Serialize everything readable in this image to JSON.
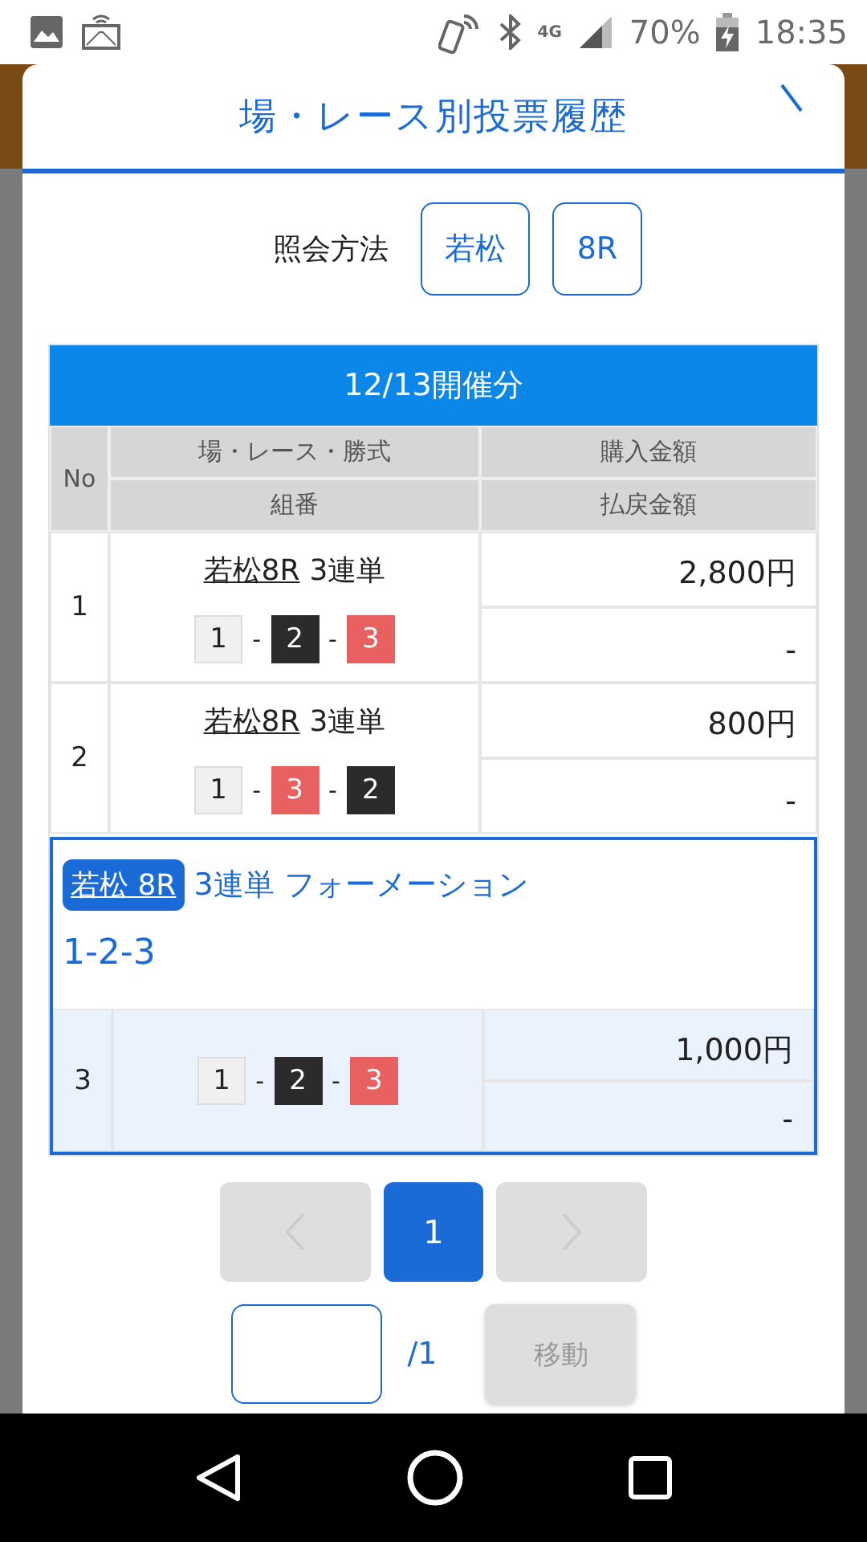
{
  "status_bar": {
    "network": "4G",
    "battery": "70%",
    "time": "18:35"
  },
  "dialog": {
    "title": "場・レース別投票履歴"
  },
  "query": {
    "label": "照会方法",
    "buttons": [
      "若松",
      "8R"
    ]
  },
  "table": {
    "date_header": "12/13開催分",
    "columns": {
      "no": "No",
      "race": "場・レース・勝式",
      "combo": "組番",
      "purchase": "購入金額",
      "payout": "払戻金額"
    },
    "rows": [
      {
        "no": "1",
        "race": "若松8R",
        "bet_type": "3連単",
        "separator": "-",
        "combo": [
          {
            "num": "1",
            "color": "#f0f0f0"
          },
          {
            "num": "2",
            "color": "#2b2b2b"
          },
          {
            "num": "3",
            "color": "#e86060"
          }
        ],
        "purchase": "2,800円",
        "payout": "-"
      },
      {
        "no": "2",
        "race": "若松8R",
        "bet_type": "3連単",
        "separator": "-",
        "combo": [
          {
            "num": "1",
            "color": "#f0f0f0"
          },
          {
            "num": "3",
            "color": "#e86060"
          },
          {
            "num": "2",
            "color": "#2b2b2b"
          }
        ],
        "purchase": "800円",
        "payout": "-"
      }
    ],
    "formation": {
      "venue": "若松 8R",
      "title": "3連単 フォーメーション",
      "combo_text": "1-2-3",
      "row": {
        "no": "3",
        "separator": "-",
        "combo": [
          {
            "num": "1",
            "color": "#f0f0f0"
          },
          {
            "num": "2",
            "color": "#2b2b2b"
          },
          {
            "num": "3",
            "color": "#e86060"
          }
        ],
        "purchase": "1,000円",
        "payout": "-"
      }
    }
  },
  "pagination": {
    "prev_disabled": true,
    "next_disabled": true,
    "pages": [
      {
        "label": "1",
        "selected": true
      }
    ],
    "total": "/1",
    "jump_button": {
      "label": "移動",
      "disabled": true
    }
  }
}
